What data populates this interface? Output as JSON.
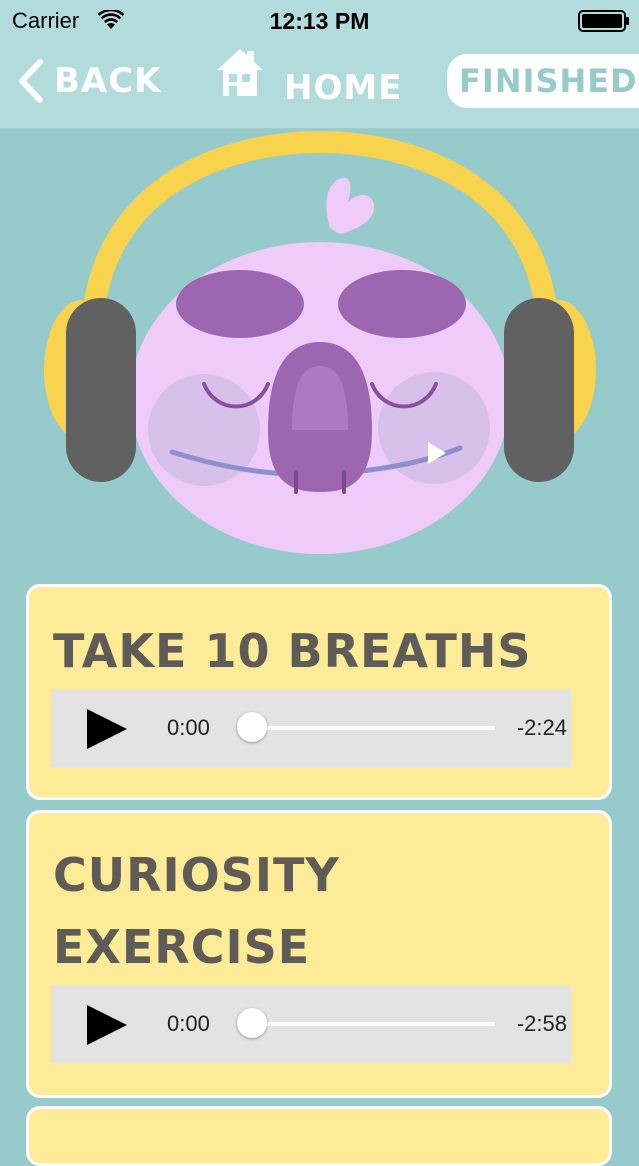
{
  "status_bar": {
    "carrier": "Carrier",
    "time": "12:13 PM",
    "icons": [
      "wifi-icon",
      "battery-icon"
    ]
  },
  "nav": {
    "back_label": "BACK",
    "home_label": "HOME",
    "finished_label": "FINISHED",
    "icons": [
      "chevron-left-icon",
      "house-icon"
    ]
  },
  "mascot": {
    "description_icon": "koala-headphones-illustration"
  },
  "colors": {
    "background": "#97cbcb",
    "nav_background": "#b2dcdb",
    "card_background": "#fdeb98",
    "title_text": "#5f5b57",
    "koala_body": "#eecbf9",
    "koala_features": "#9c66b1",
    "headphones_band": "#f8d34e",
    "headphones_cups": "#616161"
  },
  "exercises": [
    {
      "title": "TAKE 10 BREATHS",
      "player": {
        "elapsed": "0:00",
        "remaining": "-2:24",
        "progress": 0
      }
    },
    {
      "title_line1": "CURIOSITY",
      "title_line2": "EXERCISE",
      "player": {
        "elapsed": "0:00",
        "remaining": "-2:58",
        "progress": 0
      }
    }
  ]
}
